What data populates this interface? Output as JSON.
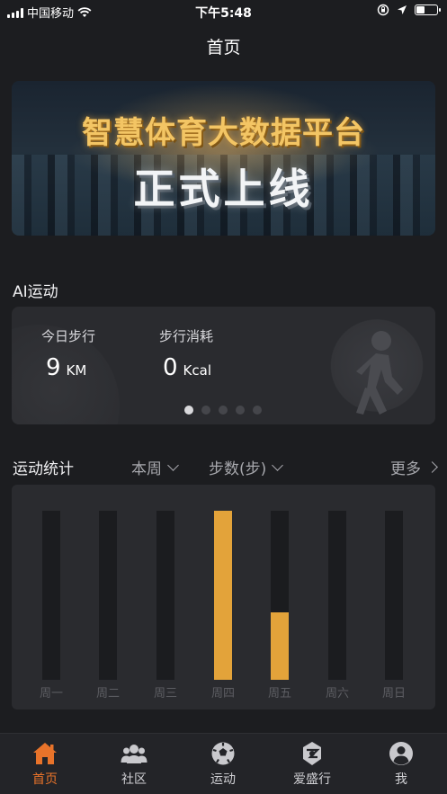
{
  "status_bar": {
    "carrier": "中国移动",
    "time": "下午5:48",
    "battery_level": 0.45
  },
  "header": {
    "title": "首页"
  },
  "banner": {
    "line1": "智慧体育大数据平台",
    "line2": "正式上线"
  },
  "ai_section": {
    "title": "AI运动",
    "stats": [
      {
        "label": "今日步行",
        "value": "9",
        "unit": "KM"
      },
      {
        "label": "步行消耗",
        "value": "0",
        "unit": "Kcal"
      }
    ],
    "pager": {
      "count": 5,
      "active": 0
    },
    "icon": "walking-person-icon"
  },
  "stats_section": {
    "title": "运动统计",
    "period_select": "本周",
    "metric_select": "步数(步)",
    "more_label": "更多"
  },
  "chart_data": {
    "type": "bar",
    "categories": [
      "周一",
      "周二",
      "周三",
      "周四",
      "周五",
      "周六",
      "周日"
    ],
    "values": [
      0,
      0,
      0,
      1.0,
      0.4,
      0,
      0
    ],
    "bar_color": "#e3a33a",
    "track_color": "#1b1c1f"
  },
  "tab_bar": {
    "items": [
      {
        "label": "首页",
        "icon": "home-icon",
        "active": true
      },
      {
        "label": "社区",
        "icon": "community-icon",
        "active": false
      },
      {
        "label": "运动",
        "icon": "soccer-ball-icon",
        "active": false
      },
      {
        "label": "爱盛行",
        "icon": "ai-sheng-xing-icon",
        "active": false
      },
      {
        "label": "我",
        "icon": "user-profile-icon",
        "active": false
      }
    ],
    "active_color": "#e8732a"
  }
}
